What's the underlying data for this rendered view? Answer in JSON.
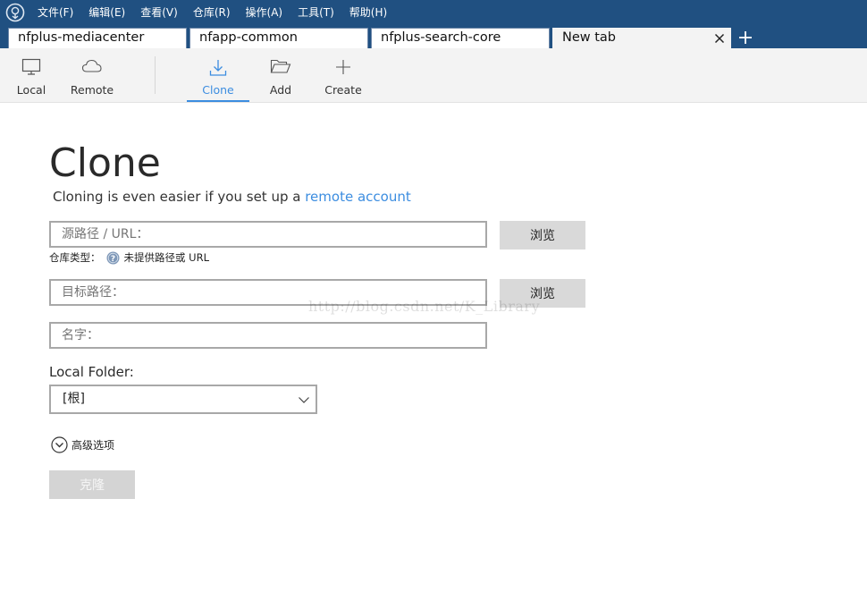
{
  "menu": {
    "items": [
      {
        "label": "文件(F)"
      },
      {
        "label": "编辑(E)"
      },
      {
        "label": "查看(V)"
      },
      {
        "label": "仓库(R)"
      },
      {
        "label": "操作(A)"
      },
      {
        "label": "工具(T)"
      },
      {
        "label": "帮助(H)"
      }
    ]
  },
  "tabs": [
    {
      "label": "nfplus-mediacenter"
    },
    {
      "label": "nfapp-common"
    },
    {
      "label": "nfplus-search-core"
    },
    {
      "label": "New tab",
      "active": true
    }
  ],
  "toolbar": {
    "local": "Local",
    "remote": "Remote",
    "clone": "Clone",
    "add": "Add",
    "create": "Create",
    "selected": "Clone"
  },
  "main": {
    "title": "Clone",
    "subtitle_prefix": "Cloning is even easier if you set up a ",
    "subtitle_link": "remote account",
    "source_placeholder": "源路径 / URL：",
    "browse_label": "浏览",
    "repo_type_label": "仓库类型：",
    "repo_type_value": "未提供路径或 URL",
    "dest_placeholder": "目标路径：",
    "name_placeholder": "名字：",
    "local_folder_label": "Local Folder:",
    "local_folder_value": "[根]",
    "advanced_label": "高级选项",
    "clone_button": "克隆"
  },
  "watermark": "http://blog.csdn.net/K_Library",
  "colors": {
    "titlebar": "#205081",
    "accent": "#3c8de0",
    "toolbar_bg": "#f3f3f3"
  }
}
